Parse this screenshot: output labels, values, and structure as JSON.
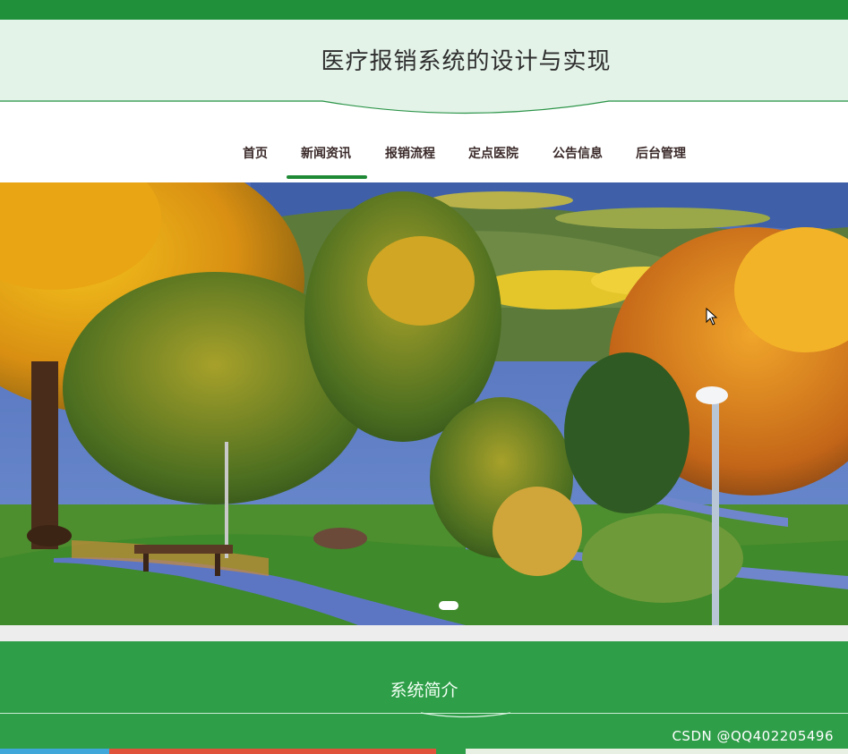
{
  "header": {
    "title": "医疗报销系统的设计与实现"
  },
  "nav": {
    "items": [
      {
        "label": "首页"
      },
      {
        "label": "新闻资讯"
      },
      {
        "label": "报销流程"
      },
      {
        "label": "定点医院"
      },
      {
        "label": "公告信息"
      },
      {
        "label": "后台管理"
      }
    ],
    "active_index": 1
  },
  "banner": {
    "slide_count_visible": 1,
    "active_slide": 1
  },
  "intro": {
    "title": "系统简介"
  },
  "watermark": "CSDN @QQ402205496",
  "colors": {
    "brand_green": "#21903b",
    "section_green": "#2f9e49",
    "header_bg": "#e3f3e8"
  }
}
